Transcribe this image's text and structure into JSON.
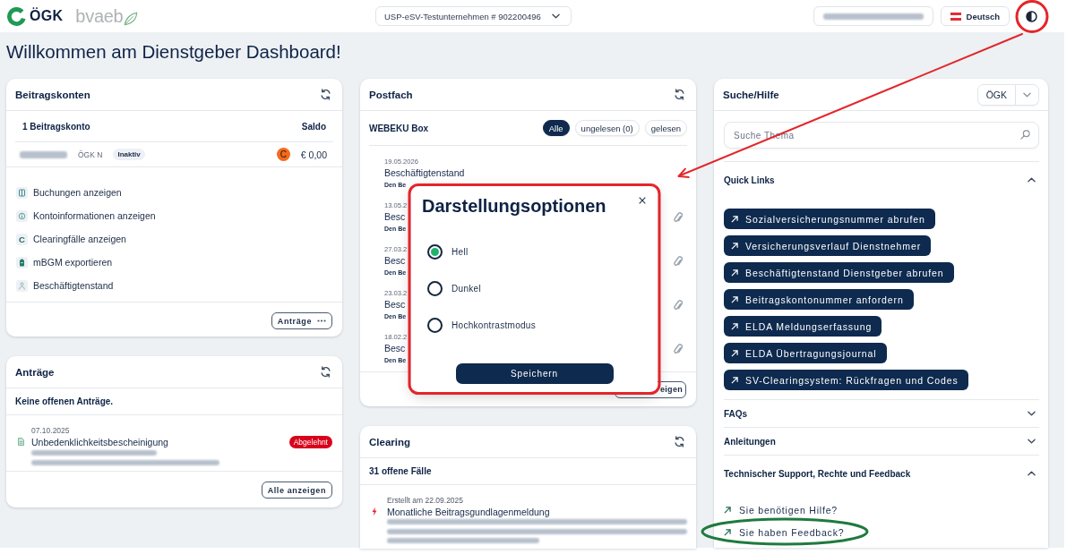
{
  "header": {
    "brand": "ÖGK",
    "partner_brand": "bvaeb",
    "company_select": {
      "value": "USP-eSV-Testunternehmen # 902200496"
    },
    "language": {
      "label": "Deutsch"
    }
  },
  "page_title": "Willkommen am Dienstgeber Dashboard!",
  "contribution_accounts": {
    "title": "Beitragskonten",
    "count_label": "1 Beitragskonto",
    "balance_heading": "Saldo",
    "accounts": [
      {
        "carrier": "ÖGK N",
        "status": "Inaktiv",
        "marker": "C",
        "balance": "€ 0,00"
      }
    ],
    "actions": [
      {
        "label": "Buchungen anzeigen",
        "kind": "ledger"
      },
      {
        "label": "Kontoinformationen anzeigen",
        "kind": "info"
      },
      {
        "label": "Clearingfälle anzeigen",
        "kind": "letter",
        "glyph": "C"
      },
      {
        "label": "mBGM exportieren",
        "kind": "export"
      },
      {
        "label": "Beschäftigtenstand",
        "kind": "people"
      }
    ],
    "menu_button": "Anträge"
  },
  "requests": {
    "title": "Anträge",
    "summary": "Keine offenen Anträge.",
    "items": [
      {
        "date": "07.10.2025",
        "title": "Unbedenklichkeitsbescheinigung",
        "status": "Abgelehnt"
      }
    ],
    "button": "Alle anzeigen"
  },
  "mailbox": {
    "title": "Postfach",
    "box_label": "WEBEKU Box",
    "filters": [
      {
        "label": "Alle",
        "selected": true
      },
      {
        "label": "ungelesen (0)",
        "selected": false
      },
      {
        "label": "gelesen",
        "selected": false
      }
    ],
    "messages": [
      {
        "date": "19.05.2026",
        "title": "Beschäftigtenstand",
        "sender": "Den Be",
        "attachment": false
      },
      {
        "date": "13.05.2",
        "title": "Besc",
        "sender": "Den Be",
        "attachment": true
      },
      {
        "date": "27.03.2",
        "title": "Besc",
        "sender": "Den Be",
        "attachment": true
      },
      {
        "date": "23.03.2",
        "title": "Besc",
        "sender": "Den Be",
        "attachment": true
      },
      {
        "date": "18.02.2",
        "title": "Besc",
        "sender": "Den Be",
        "attachment": true
      }
    ],
    "button": "eigen"
  },
  "clearing": {
    "title": "Clearing",
    "summary": "31 offene Fälle",
    "items": [
      {
        "created": "Erstellt am 22.09.2025",
        "title": "Monatliche Beitragsgundlagenmeldung"
      }
    ]
  },
  "search_help": {
    "title": "Suche/Hilfe",
    "carrier_select": {
      "value": "ÖGK"
    },
    "search": {
      "placeholder": "Suche Thema"
    },
    "sections": [
      {
        "title": "Quick Links",
        "expanded": true,
        "kind": "buttons",
        "links": [
          "Sozialversicherungsnummer abrufen",
          "Versicherungsverlauf Dienstnehmer",
          "Beschäftigtenstand Dienstgeber abrufen",
          "Beitragskontonummer anfordern",
          "ELDA Meldungserfassung",
          "ELDA Übertragungsjournal",
          "SV-Clearingsystem: Rückfragen und Codes"
        ]
      },
      {
        "title": "FAQs",
        "expanded": false
      },
      {
        "title": "Anleitungen",
        "expanded": false
      },
      {
        "title": "Technischer Support, Rechte und Feedback",
        "expanded": true,
        "kind": "links",
        "links": [
          "Sie benötigen Hilfe?",
          "Sie haben Feedback?"
        ]
      }
    ]
  },
  "display_dialog": {
    "title": "Darstellungsoptionen",
    "options": [
      {
        "label": "Hell",
        "selected": true
      },
      {
        "label": "Dunkel",
        "selected": false
      },
      {
        "label": "Hochkontrastmodus",
        "selected": false
      }
    ],
    "button": "Speichern"
  },
  "annotations": [
    {
      "kind": "circle",
      "color": "#e3262b"
    },
    {
      "kind": "arrow",
      "color": "#e3262b"
    },
    {
      "kind": "frame",
      "color": "#e3262b"
    },
    {
      "kind": "ellipse",
      "color": "#1f7a3e"
    }
  ]
}
